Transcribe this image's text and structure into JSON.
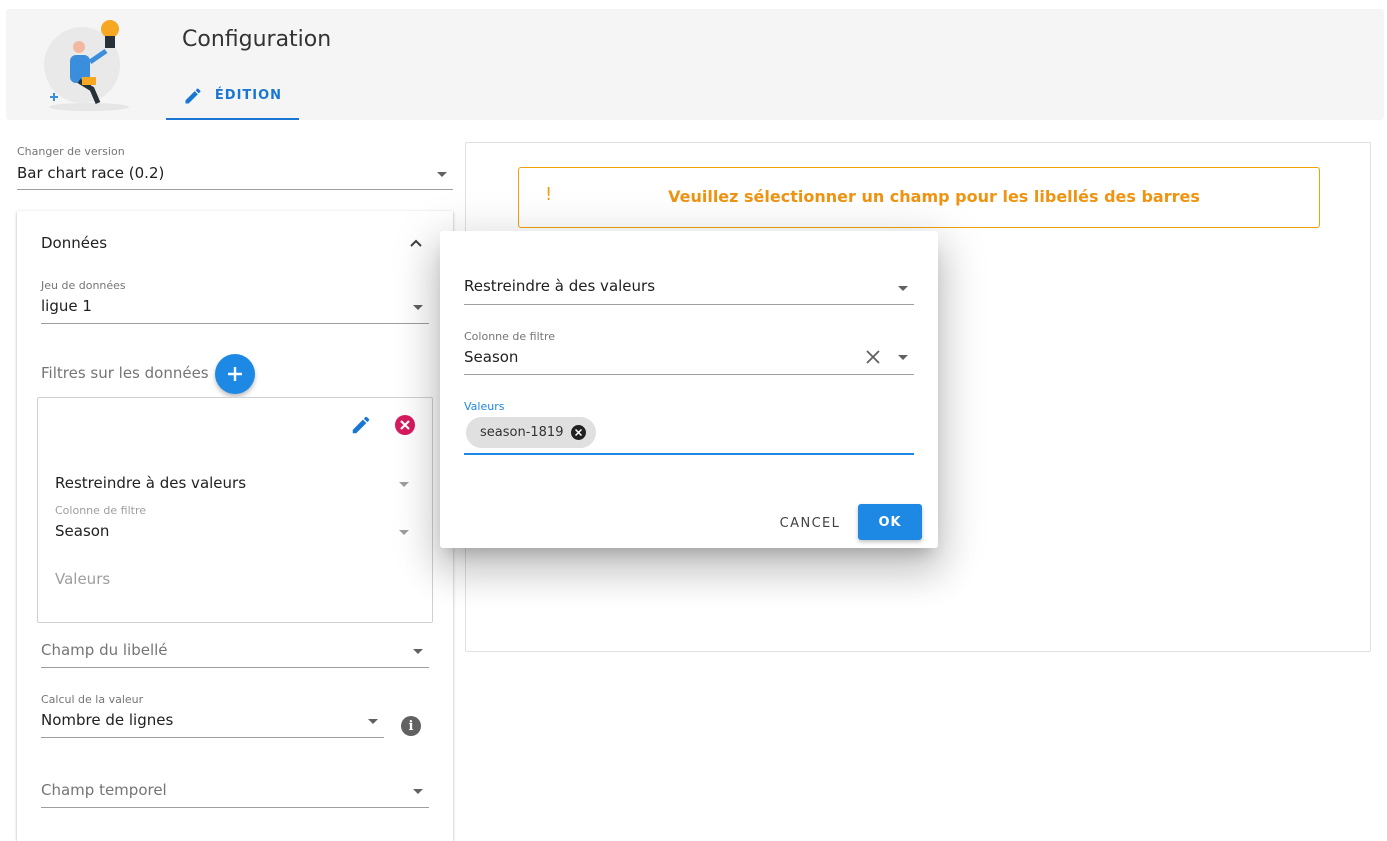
{
  "header": {
    "title": "Configuration",
    "tab_label": "ÉDITION"
  },
  "version_select": {
    "label": "Changer de version",
    "value": "Bar chart race (0.2)"
  },
  "data_panel": {
    "title": "Données",
    "dataset": {
      "label": "Jeu de données",
      "value": "ligue 1"
    },
    "filters_label": "Filtres sur les données",
    "filter_card": {
      "type_value": "Restreindre à des valeurs",
      "column_label": "Colonne de filtre",
      "column_value": "Season",
      "values_placeholder": "Valeurs"
    },
    "label_field": {
      "placeholder": "Champ du libellé"
    },
    "value_calc": {
      "label": "Calcul de la valeur",
      "value": "Nombre de lignes"
    },
    "time_field": {
      "placeholder": "Champ temporel"
    }
  },
  "preview": {
    "warning_icon": "!",
    "warning_message": "Veuillez sélectionner un champ pour les libellés des barres",
    "warning_color": "#ef9411"
  },
  "dialog": {
    "type_value": "Restreindre à des valeurs",
    "column_label": "Colonne de filtre",
    "column_value": "Season",
    "values_label": "Valeurs",
    "chips": [
      "season-1819"
    ],
    "cancel_label": "CANCEL",
    "ok_label": "OK"
  },
  "colors": {
    "primary": "#1e88e5",
    "danger": "#d81b60",
    "warning_border": "#f1a10b"
  },
  "icons": [
    "pencil-icon",
    "add-icon",
    "delete-circle-icon",
    "chevron-up-icon",
    "info-icon",
    "clear-icon",
    "dropdown-caret-icon"
  ]
}
